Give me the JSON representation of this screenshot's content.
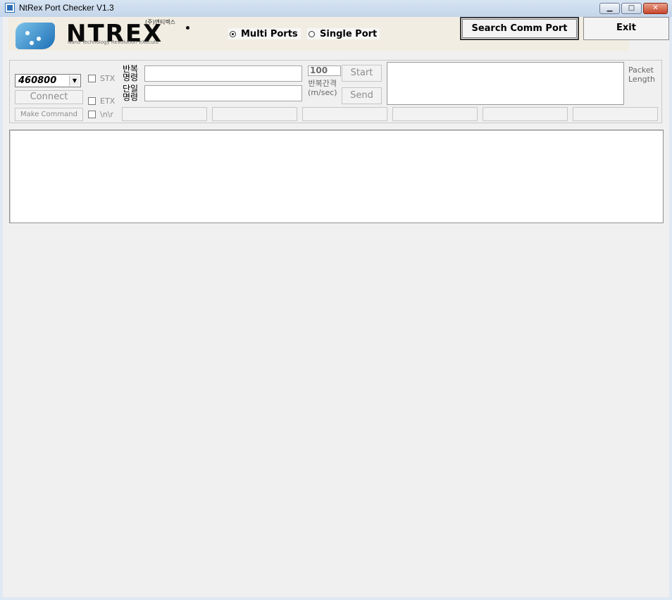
{
  "window": {
    "title": "NtRex Port Checker V1.3",
    "controls": {
      "minimize": "▁",
      "maximize": "□",
      "close": "✕"
    }
  },
  "logo": {
    "wordmark": "NTREX",
    "korean": "(주)엔티렉스",
    "tagline": "Nano Technology Revolution eXecute"
  },
  "mode": {
    "options": [
      {
        "label": "Multi Ports",
        "selected": true
      },
      {
        "label": "Single Port",
        "selected": false
      }
    ]
  },
  "toolbar": {
    "search_label": "Search Comm Port",
    "exit_label": "Exit"
  },
  "serial": {
    "baud_rate": "460800",
    "connect_label": "Connect",
    "make_command_label": "Make Command",
    "stx_label": "STX",
    "etx_label": "ETX",
    "newline_label": "\\n\\r"
  },
  "commands": {
    "repeat_label_1": "반복",
    "repeat_label_2": "명령",
    "single_label_1": "단일",
    "single_label_2": "명령",
    "repeat_value": "",
    "single_value": "",
    "interval_value": "100",
    "interval_label_1": "반복간격",
    "interval_label_2": "(m/sec)",
    "start_label": "Start",
    "send_label": "Send"
  },
  "packet": {
    "label_1": "Packet",
    "label_2": "Length"
  },
  "colors": {
    "titlebar": "#c4d5ea",
    "client_bg": "#f0f0f0",
    "disabled_text": "#8d8d8d",
    "logo_blue": "#1c6fb6"
  }
}
